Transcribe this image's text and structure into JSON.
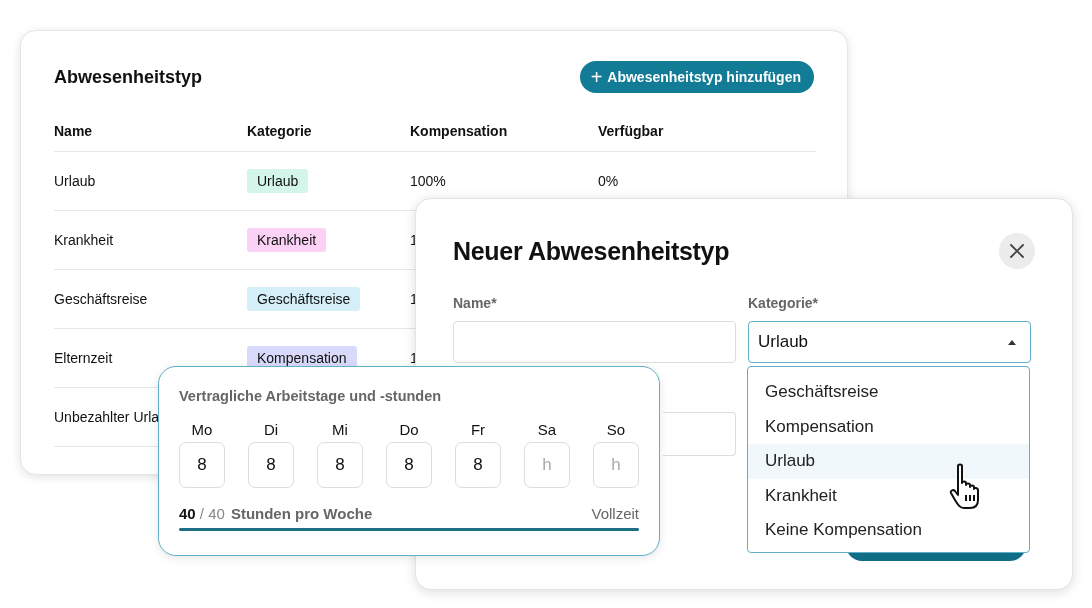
{
  "absence_table": {
    "title": "Abwesenheitstyp",
    "add_button": {
      "icon": "+",
      "label": "Abwesenheitstyp hinzufügen"
    },
    "columns": [
      "Name",
      "Kategorie",
      "Kompensation",
      "Verfügbar"
    ],
    "rows": [
      {
        "name": "Urlaub",
        "category": {
          "label": "Urlaub",
          "color": "#d4f5e9"
        },
        "compensation": "100%",
        "available": "0%"
      },
      {
        "name": "Krankheit",
        "category": {
          "label": "Krankheit",
          "color": "#fbd2f6"
        },
        "compensation": "1"
      },
      {
        "name": "Geschäftsreise",
        "category": {
          "label": "Geschäftsreise",
          "color": "#d5eff8"
        },
        "compensation": "1"
      },
      {
        "name": "Elternzeit",
        "category": {
          "label": "Kompensation",
          "color": "#d9d9fb"
        },
        "compensation": "1"
      },
      {
        "name": "Unbezahlter Urla"
      }
    ]
  },
  "dialog": {
    "title": "Neuer Abwesenheitstyp",
    "name_field": {
      "label": "Name*"
    },
    "category_field": {
      "label": "Kategorie*",
      "value": "Urlaub",
      "expanded": true,
      "options": [
        {
          "label": "Geschäftsreise",
          "selected": false
        },
        {
          "label": "Kompensation",
          "selected": false
        },
        {
          "label": "Urlaub",
          "selected": true
        },
        {
          "label": "Krankheit",
          "selected": false
        },
        {
          "label": "Keine Kompensation",
          "selected": false
        }
      ]
    }
  },
  "work_hours": {
    "title": "Vertragliche Arbeitstage und -stunden",
    "days": [
      {
        "day": "Mo",
        "value": "8"
      },
      {
        "day": "Di",
        "value": "8"
      },
      {
        "day": "Mi",
        "value": "8"
      },
      {
        "day": "Do",
        "value": "8"
      },
      {
        "day": "Fr",
        "value": "8"
      },
      {
        "day": "Sa",
        "placeholder": "h"
      },
      {
        "day": "So",
        "placeholder": "h"
      }
    ],
    "total": "**40** / 40",
    "unit": "Stunden pro Woche",
    "mode": "Vollzeit",
    "level": 1
  }
}
